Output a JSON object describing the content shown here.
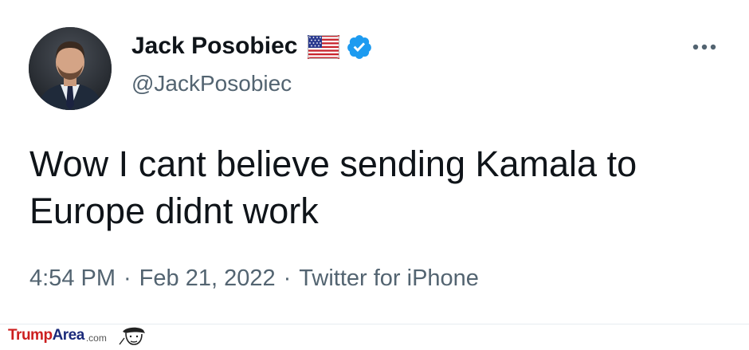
{
  "author": {
    "name": "Jack Posobiec",
    "handle": "@JackPosobiec"
  },
  "icons": {
    "flag": "us-flag-icon",
    "verified": "verified-badge-icon",
    "more": "more-options-icon"
  },
  "tweet": {
    "text": "Wow I cant believe sending Kamala to Europe didnt work",
    "time": "4:54 PM",
    "date": "Feb 21, 2022",
    "source": "Twitter for iPhone",
    "separator": "·"
  },
  "watermark": {
    "brand_part1": "Trump",
    "brand_part2": "Area",
    "brand_suffix": ".com"
  },
  "colors": {
    "verified": "#1d9bf0",
    "text": "#0f1419",
    "secondary": "#536471"
  }
}
